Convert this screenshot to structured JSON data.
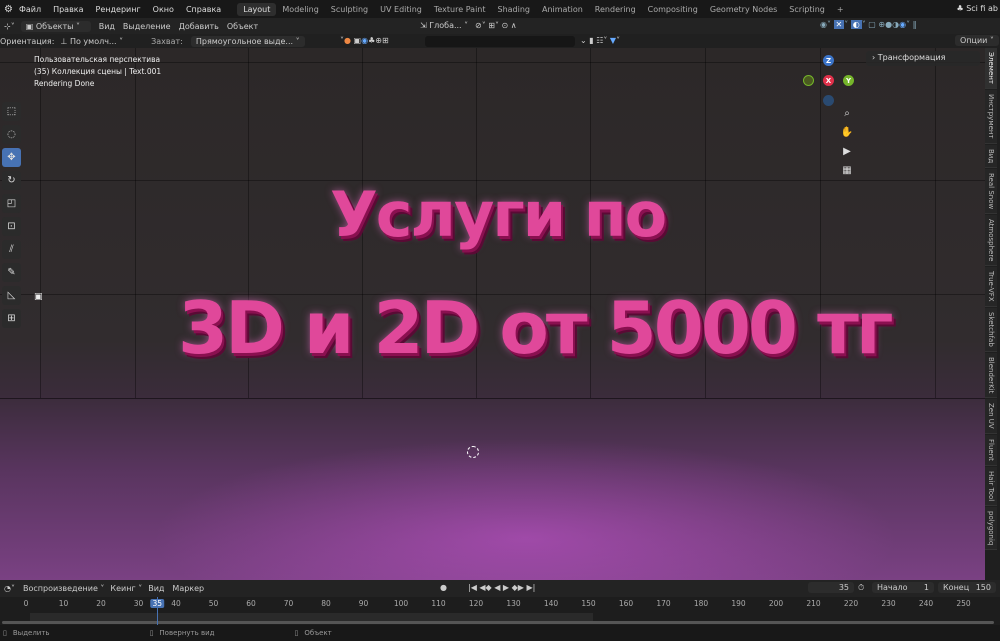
{
  "topbar": {
    "menus": [
      "Файл",
      "Правка",
      "Рендеринг",
      "Окно",
      "Справка"
    ],
    "workspaces": [
      "Layout",
      "Modeling",
      "Sculpting",
      "UV Editing",
      "Texture Paint",
      "Shading",
      "Animation",
      "Rendering",
      "Compositing",
      "Geometry Nodes",
      "Scripting"
    ],
    "active_workspace": "Layout",
    "add": "+",
    "scene": "Sci fi ab"
  },
  "header": {
    "mode": "Объекты",
    "menus": [
      "Вид",
      "Выделение",
      "Добавить",
      "Объект"
    ],
    "transform": "Глоба...",
    "options": "Опции"
  },
  "tool_options": {
    "orientation_label": "Ориентация:",
    "orientation_value": "По умолч...",
    "snap_label": "Захват:",
    "snap_value": "Прямоугольное выде...",
    "search_placeholder": ""
  },
  "overlay": {
    "line1": "Пользовательская перспектива",
    "line2": "(35) Коллекция сцены | Text.001",
    "line3": "Rendering Done"
  },
  "scene_text": {
    "line1": "Услуги по",
    "line2": "3D и 2D от 5000 тг"
  },
  "gizmo": {
    "x": "X",
    "y": "Y",
    "z": "Z"
  },
  "n_panel": {
    "transform": "Трансформация"
  },
  "side_tabs": [
    "Элемент",
    "Инструмент",
    "Вид",
    "Real Snow",
    "Atmosphere",
    "True-VFX",
    "Sketchfab",
    "BlenderKit",
    "Zen UV",
    "Fluent",
    "Hair Tool",
    "polygoniq"
  ],
  "timeline": {
    "menus": [
      "Воспроизведение",
      "Кеинг",
      "Вид",
      "Маркер"
    ],
    "current_frame": "35",
    "start_label": "Начало",
    "start": "1",
    "end_label": "Конец",
    "end": "150",
    "ticks": [
      "0",
      "10",
      "20",
      "30",
      "35",
      "40",
      "50",
      "60",
      "70",
      "80",
      "90",
      "100",
      "110",
      "120",
      "130",
      "140",
      "150",
      "160",
      "170",
      "180",
      "190",
      "200",
      "210",
      "220",
      "230",
      "240",
      "250"
    ]
  },
  "status": {
    "select": "Выделить",
    "rotate": "Повернуть вид",
    "object": "Объект"
  }
}
